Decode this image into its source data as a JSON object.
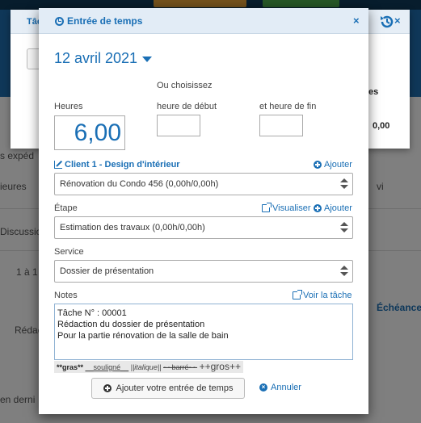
{
  "background": {
    "dialog_title": "Tâc",
    "stat_label": "es",
    "stat_value": "0,00",
    "left_fragments": [
      "s expéd",
      "ieures",
      "Discussio",
      "1 à 1",
      "Rédac",
      "en derni"
    ],
    "right_fragments": [
      "vi",
      "Échéance"
    ]
  },
  "modal": {
    "title": "Entrée de temps",
    "close_label": "×",
    "date": "12 avril 2021",
    "or_choose": "Ou choisissez",
    "hours_label": "Heures",
    "hours_value": "6,00",
    "start_label": "heure de début",
    "end_label": "et heure de fin",
    "client_label": "Client 1 - Design d'intérieur",
    "client_add": "Ajouter",
    "project_value": "Rénovation du Condo 456 (0,00h/0,00h)",
    "step_label": "Étape",
    "step_view": "Visualiser",
    "step_add": "Ajouter",
    "step_value": "Estimation des travaux (0,00h/0,00h)",
    "service_label": "Service",
    "service_value": "Dossier de présentation",
    "notes_label": "Notes",
    "notes_view_task": "Voir la tâche",
    "notes_value": "Tâche  N° : 00001\nRédaction du dossier de présentation\nPour la partie rénovation de la salle de bain",
    "format_bar": {
      "bold": "**gras**",
      "underline": "__souligné__",
      "italic": "||italique||",
      "strike": "~~barré~~",
      "big": "++gros++"
    },
    "submit_label": "Ajouter votre entrée de temps",
    "cancel_label": "Annuler"
  },
  "colors": {
    "accent": "#1a6fb5",
    "header_bg": "#e2ecf6"
  }
}
